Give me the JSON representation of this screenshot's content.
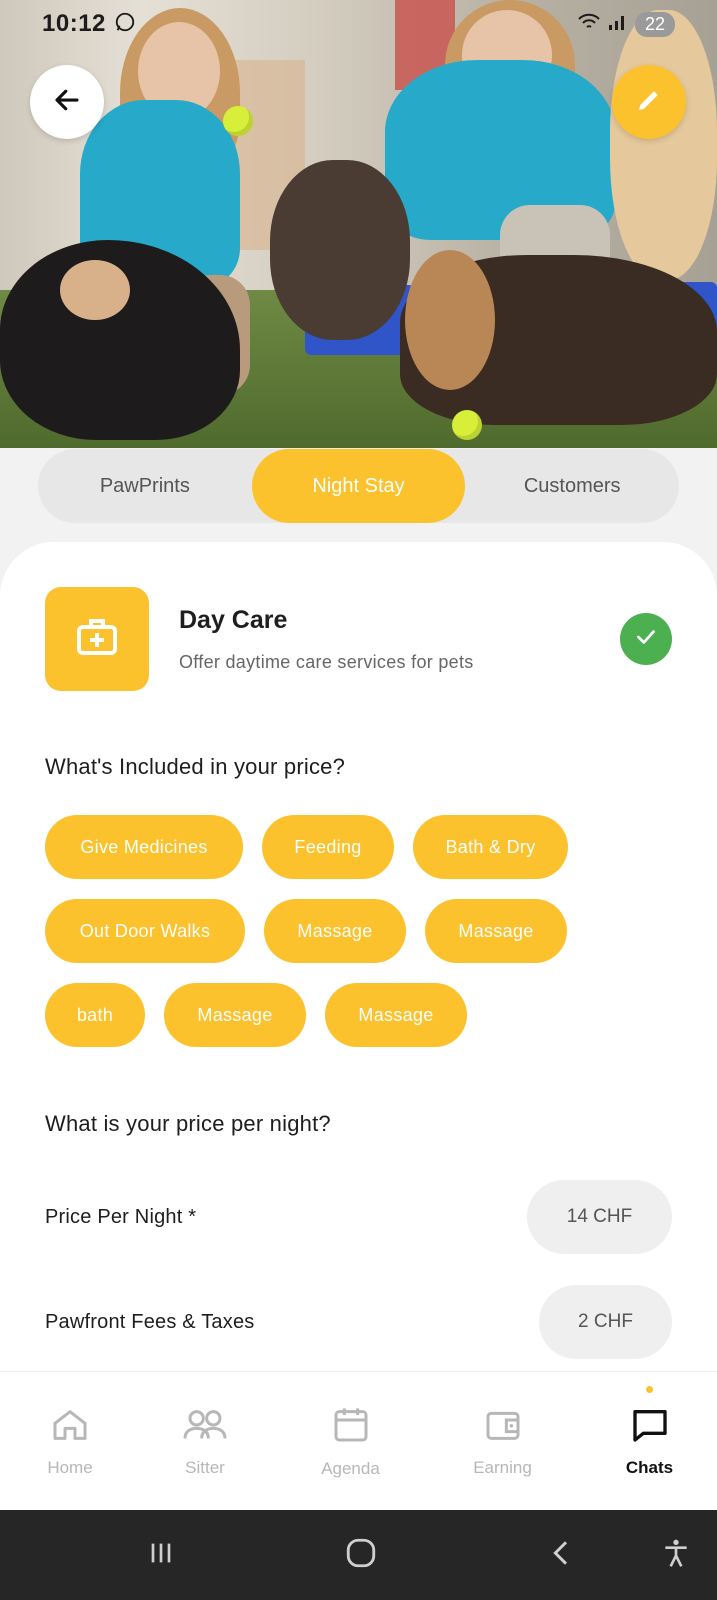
{
  "status": {
    "time": "10:12",
    "battery": "22"
  },
  "tabs": [
    {
      "label": "PawPrints"
    },
    {
      "label": "Night Stay",
      "active": true
    },
    {
      "label": "Customers"
    }
  ],
  "service": {
    "title": "Day Care",
    "description": "Offer daytime care services for pets",
    "icon": "first-aid-kit-icon",
    "status_icon": "check-icon"
  },
  "included": {
    "heading": "What's Included in your price?",
    "chips": [
      "Give Medicines",
      "Feeding",
      "Bath & Dry",
      "Out Door Walks",
      "Massage",
      "Massage",
      "bath",
      "Massage",
      "Massage"
    ]
  },
  "pricing": {
    "heading": "What is your price per night?",
    "rows": [
      {
        "label": "Price Per Night *",
        "value": "14 CHF"
      },
      {
        "label": "Pawfront Fees & Taxes",
        "value": "2 CHF"
      }
    ]
  },
  "bottom_nav": [
    {
      "label": "Home",
      "icon": "home-icon"
    },
    {
      "label": "Sitter",
      "icon": "people-icon"
    },
    {
      "label": "Agenda",
      "icon": "calendar-icon"
    },
    {
      "label": "Earning",
      "icon": "wallet-icon"
    },
    {
      "label": "Chats",
      "icon": "chat-icon",
      "active": true
    }
  ],
  "colors": {
    "accent": "#fcc22d",
    "success": "#4caf50",
    "nav_inactive": "#b7b7b7"
  }
}
